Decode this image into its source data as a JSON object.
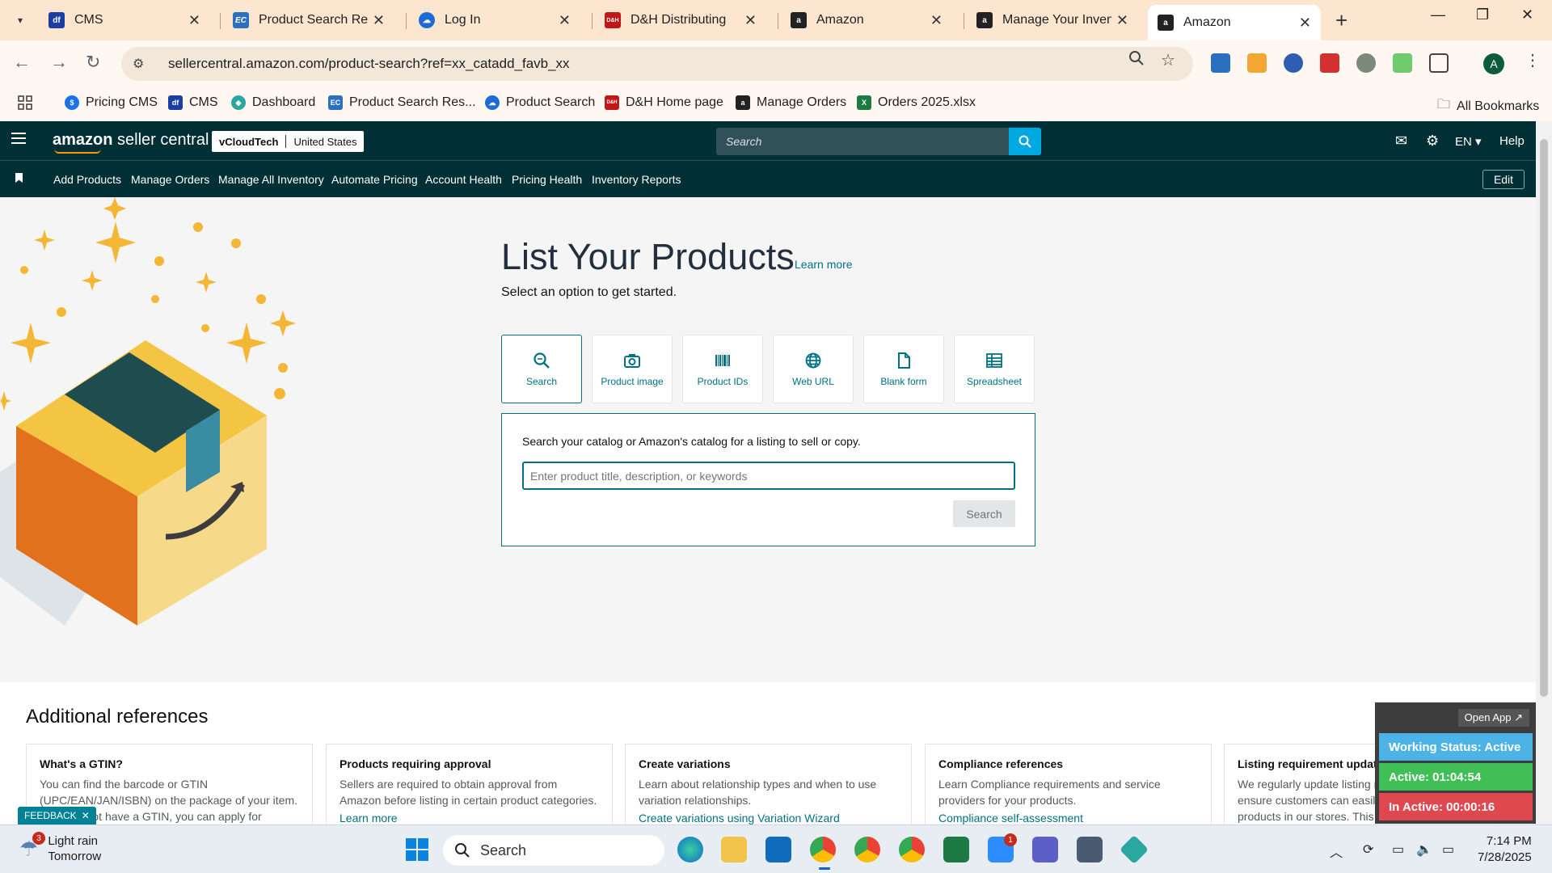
{
  "browser": {
    "tabs": [
      {
        "title": "CMS",
        "favicon": "df",
        "color": "#1a3fa0"
      },
      {
        "title": "Product Search Resul",
        "favicon": "EC",
        "color": "#2b6fbf"
      },
      {
        "title": "Log In",
        "favicon": "cloud",
        "color": "#1e6bd6"
      },
      {
        "title": "D&H Distributing",
        "favicon": "D&H",
        "color": "#c01818"
      },
      {
        "title": "Amazon",
        "favicon": "a",
        "color": "#222222"
      },
      {
        "title": "Manage Your Invento",
        "favicon": "a",
        "color": "#222222"
      },
      {
        "title": "Amazon",
        "favicon": "a",
        "color": "#222222"
      }
    ],
    "url": "sellercentral.amazon.com/product-search?ref=xx_catadd_favb_xx",
    "bookmarks": [
      {
        "label": "Pricing CMS",
        "favicon": "$",
        "color": "#1a73e8"
      },
      {
        "label": "CMS",
        "favicon": "df",
        "color": "#1a3fa0"
      },
      {
        "label": "Dashboard",
        "favicon": "◆",
        "color": "#2aa7a0"
      },
      {
        "label": "Product Search Res...",
        "favicon": "EC",
        "color": "#2b6fbf"
      },
      {
        "label": "Product Search",
        "favicon": "cloud",
        "color": "#1e6bd6"
      },
      {
        "label": "D&H Home page",
        "favicon": "D&H",
        "color": "#c01818"
      },
      {
        "label": "Manage Orders",
        "favicon": "a",
        "color": "#222222"
      },
      {
        "label": "Orders 2025.xlsx",
        "favicon": "X",
        "color": "#1d7a43"
      }
    ],
    "all_bookmarks": "All Bookmarks",
    "profile_initial": "A"
  },
  "seller": {
    "logo_bold": "amazon",
    "logo_rest": " seller central",
    "store": "vCloudTech",
    "marketplace": "United States",
    "search_placeholder": "Search",
    "lang": "EN",
    "help": "Help",
    "nav": [
      "Add Products",
      "Manage Orders",
      "Manage All Inventory",
      "Automate Pricing",
      "Account Health",
      "Pricing Health",
      "Inventory Reports"
    ],
    "edit": "Edit"
  },
  "main": {
    "title": "List Your Products",
    "learn_more": "Learn more",
    "subtitle": "Select an option to get started.",
    "options": [
      {
        "label": "Search",
        "icon": "search-icon"
      },
      {
        "label": "Product image",
        "icon": "camera-icon"
      },
      {
        "label": "Product IDs",
        "icon": "barcode-icon"
      },
      {
        "label": "Web URL",
        "icon": "globe-icon"
      },
      {
        "label": "Blank form",
        "icon": "document-icon"
      },
      {
        "label": "Spreadsheet",
        "icon": "spreadsheet-icon"
      }
    ],
    "panel_text": "Search your catalog or Amazon's catalog for a listing to sell or copy.",
    "input_placeholder": "Enter product title, description, or keywords",
    "search_button": "Search"
  },
  "references": {
    "title": "Additional references",
    "cards": [
      {
        "title": "What's a GTIN?",
        "desc": "You can find the barcode or GTIN (UPC/EAN/JAN/ISBN) on the package of your item. If you do not have a GTIN, you can apply for",
        "link": ""
      },
      {
        "title": "Products requiring approval",
        "desc": "Sellers are required to obtain approval from Amazon before listing in certain product categories.",
        "link": "Learn more"
      },
      {
        "title": "Create variations",
        "desc": "Learn about relationship types and when to use variation relationships.",
        "link": "Create variations using Variation Wizard"
      },
      {
        "title": "Compliance references",
        "desc": "Learn Compliance requirements and service providers for your products.",
        "link": "Compliance self-assessment"
      },
      {
        "title": "Listing requirement updates",
        "desc": "We regularly update listing requirements to ensure customers can easily find and evaluate products in our stores. This includes changes to the mandatory",
        "link": ""
      }
    ]
  },
  "feedback": "FEEDBACK",
  "tracker": {
    "open_app": "Open App ↗",
    "status": "Working Status: Active",
    "active": "Active: 01:04:54",
    "inactive": "In Active: 00:00:16",
    "colors": {
      "status": "#4db3e6",
      "active": "#3fbf56",
      "inactive": "#e0484f"
    }
  },
  "taskbar": {
    "weather_title": "Light rain",
    "weather_sub": "Tomorrow",
    "weather_badge": "3",
    "search_label": "Search",
    "time": "7:14 PM",
    "date": "7/28/2025"
  },
  "colors": {
    "header": "#002f36",
    "accent": "#007185",
    "search_btn": "#00a8e1"
  }
}
